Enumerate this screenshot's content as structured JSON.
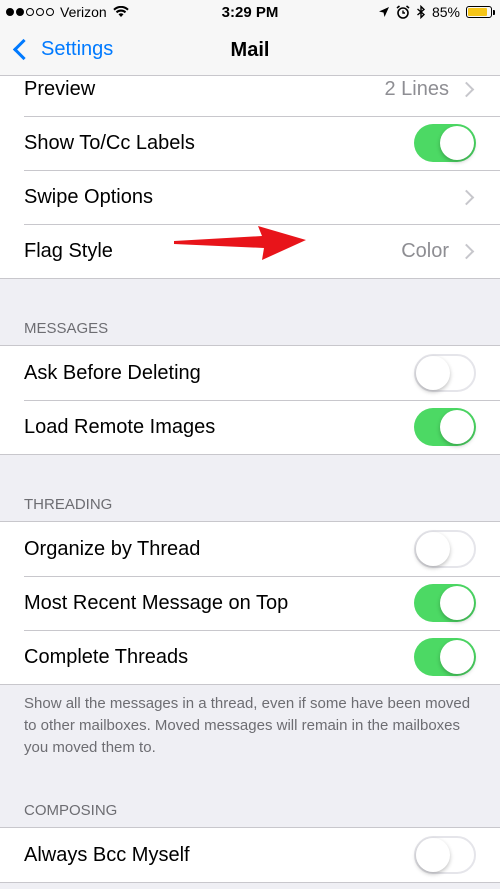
{
  "status_bar": {
    "carrier": "Verizon",
    "time": "3:29 PM",
    "battery": "85%",
    "battery_level": 0.85
  },
  "nav": {
    "back_label": "Settings",
    "title": "Mail"
  },
  "list_group": {
    "preview": {
      "label": "Preview",
      "value": "2 Lines"
    },
    "show_to_cc": {
      "label": "Show To/Cc Labels",
      "on": true
    },
    "swipe_options": {
      "label": "Swipe Options"
    },
    "flag_style": {
      "label": "Flag Style",
      "value": "Color"
    }
  },
  "messages": {
    "header": "MESSAGES",
    "ask_before_deleting": {
      "label": "Ask Before Deleting",
      "on": false
    },
    "load_remote_images": {
      "label": "Load Remote Images",
      "on": true
    }
  },
  "threading": {
    "header": "THREADING",
    "organize_by_thread": {
      "label": "Organize by Thread",
      "on": false
    },
    "most_recent_on_top": {
      "label": "Most Recent Message on Top",
      "on": true
    },
    "complete_threads": {
      "label": "Complete Threads",
      "on": true
    },
    "footer": "Show all the messages in a thread, even if some have been moved to other mailboxes. Moved messages will remain in the mailboxes you moved them to."
  },
  "composing": {
    "header": "COMPOSING",
    "always_bcc_myself": {
      "label": "Always Bcc Myself",
      "on": false
    }
  },
  "colors": {
    "accent": "#007aff",
    "toggle_on": "#4cd964",
    "annotation_arrow": "#e8141a"
  }
}
